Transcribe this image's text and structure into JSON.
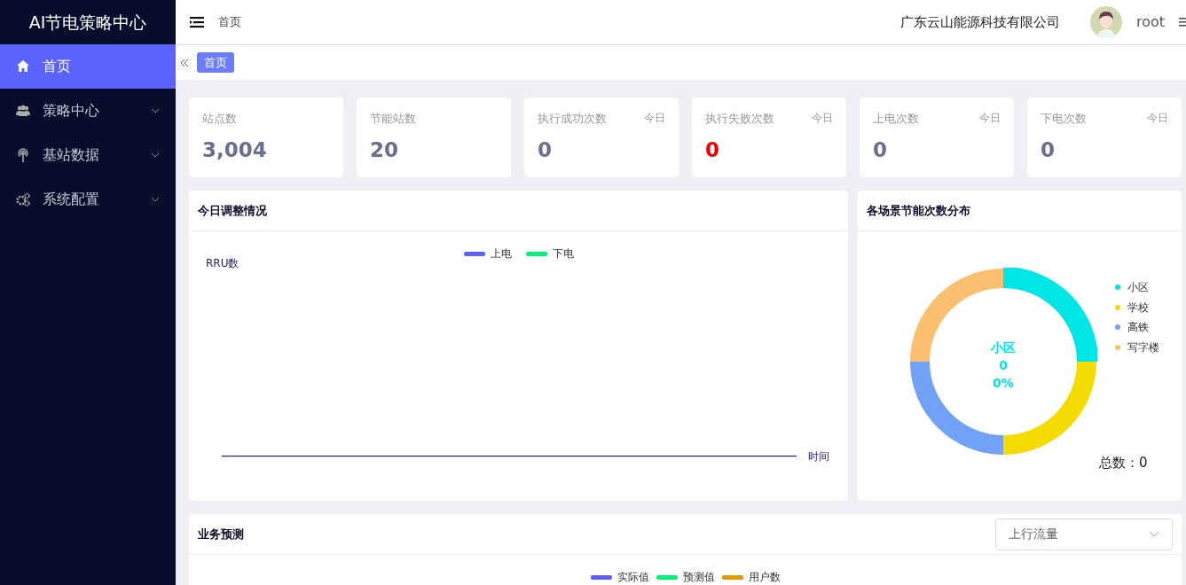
{
  "sidebar": {
    "title": "AI节电策略中心",
    "items": [
      {
        "label": "首页",
        "selected": true,
        "expandable": false
      },
      {
        "label": "策略中心",
        "selected": false,
        "expandable": true
      },
      {
        "label": "基站数据",
        "selected": false,
        "expandable": true
      },
      {
        "label": "系统配置",
        "selected": false,
        "expandable": true
      }
    ]
  },
  "header": {
    "breadcrumb": "首页",
    "company": "广东云山能源科技有限公司",
    "user": "root"
  },
  "tags": [
    {
      "label": "首页",
      "selected": true
    }
  ],
  "stats": [
    {
      "label": "站点数",
      "value": "3,004",
      "alert": false
    },
    {
      "label": "节能站数",
      "value": "20",
      "alert": false
    },
    {
      "label": "执行成功次数",
      "badge": "今日",
      "value": "0",
      "alert": false
    },
    {
      "label": "执行失败次数",
      "badge": "今日",
      "value": "0",
      "alert": true
    },
    {
      "label": "上电次数",
      "badge": "今日",
      "value": "0",
      "alert": false
    },
    {
      "label": "下电次数",
      "badge": "今日",
      "value": "0",
      "alert": false
    }
  ],
  "adjust_card": {
    "title": "今日调整情况",
    "legend": [
      {
        "label": "上电",
        "color": "#5b5ef7"
      },
      {
        "label": "下电",
        "color": "#00f07a"
      }
    ],
    "ylabel": "RRU数",
    "xlabel": "时间"
  },
  "scene_card": {
    "title": "各场景节能次数分布",
    "segments": [
      {
        "label": "小区",
        "color": "#00e5e5"
      },
      {
        "label": "学校",
        "color": "#f5dc00"
      },
      {
        "label": "高铁",
        "color": "#71a2f5"
      },
      {
        "label": "写字楼",
        "color": "#fbbf6f"
      }
    ],
    "center": [
      "小区",
      "0",
      "0%"
    ],
    "total": "总数：0"
  },
  "forecast_card": {
    "title": "业务预测",
    "select": "上行流量",
    "legend": [
      {
        "label": "实际值",
        "color": "#5b5ef7"
      },
      {
        "label": "预测值",
        "color": "#00f07a"
      },
      {
        "label": "用户数",
        "color": "#e09b00"
      }
    ]
  }
}
